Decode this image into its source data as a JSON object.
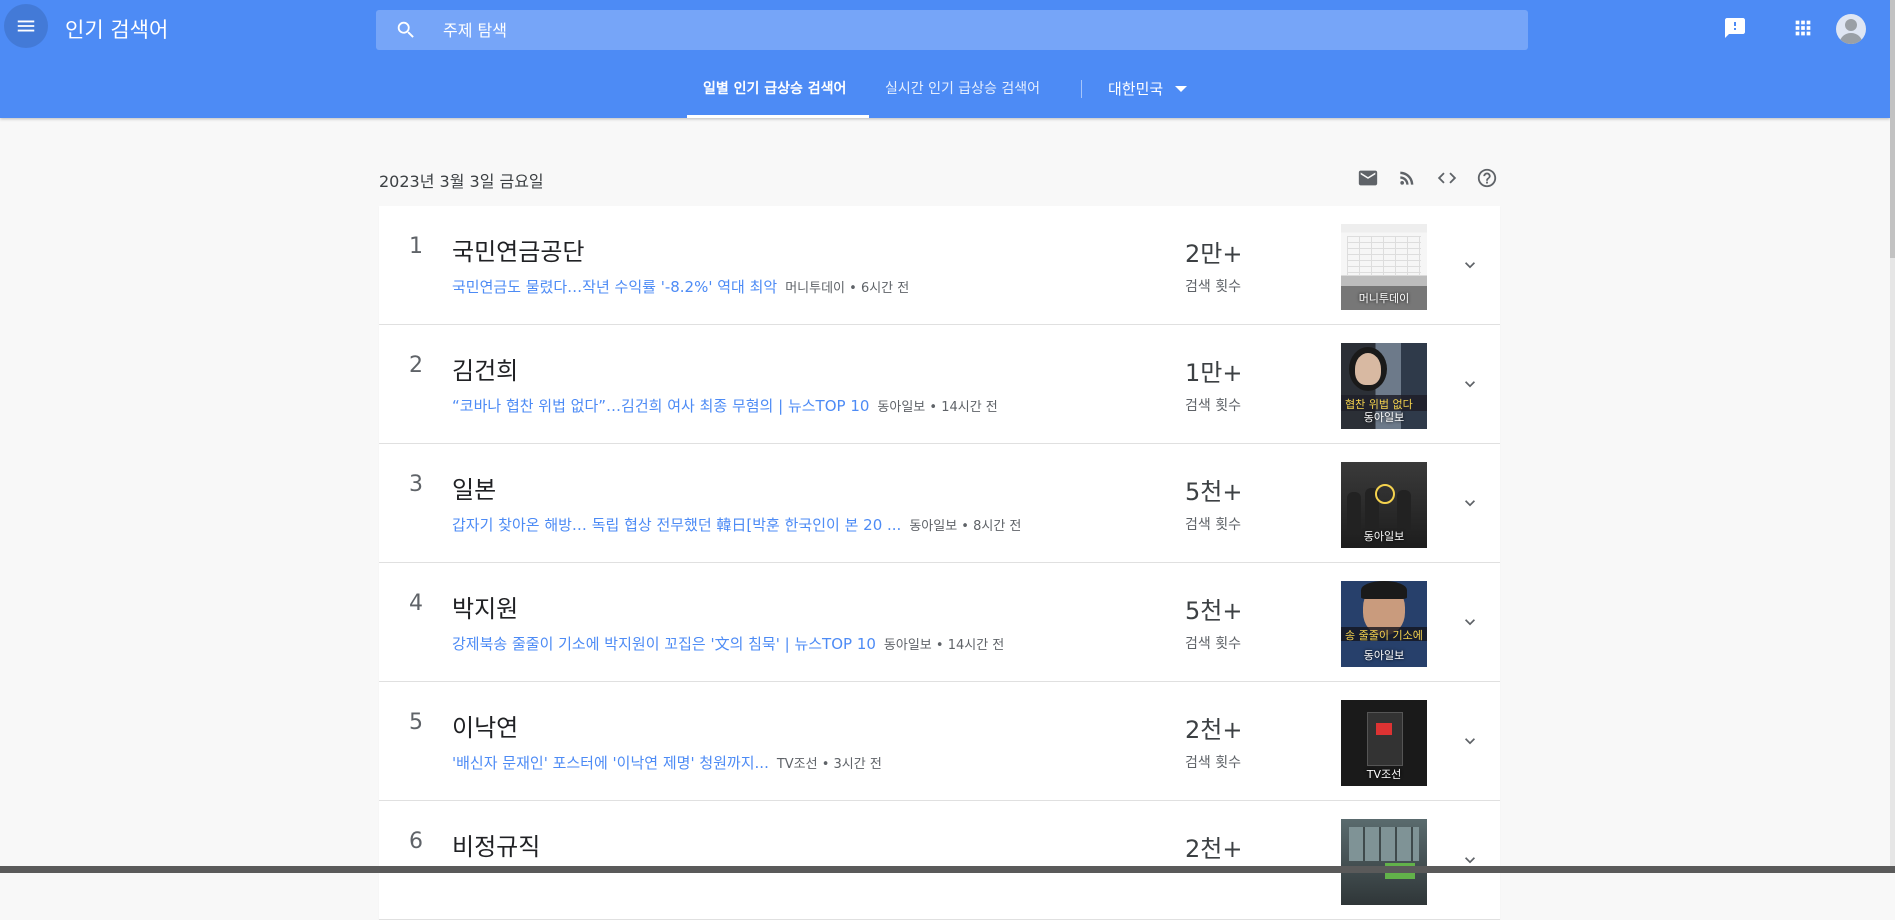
{
  "header": {
    "menu_icon": "hamburger-menu-icon",
    "title": "인기 검색어",
    "search": {
      "placeholder": "주제 탐색",
      "value": ""
    },
    "icons": [
      "feedback-icon",
      "apps-grid-icon",
      "account-avatar-icon"
    ],
    "color": "#4d8bf5"
  },
  "tabs": {
    "daily": "일별 인기 급상승 검색어",
    "realtime": "실시간 인기 급상승 검색어",
    "country": "대한민국"
  },
  "date": "2023년 3월 3일 금요일",
  "tools": [
    "email-icon",
    "rss-icon",
    "embed-code-icon",
    "help-icon"
  ],
  "count_label": "검색 횟수",
  "items": [
    {
      "rank": "1",
      "title": "국민연금공단",
      "article": "국민연금도 물렸다…작년 수익률 '-8.2%' 역대 최악",
      "source": "머니투데이 • 6시간 전",
      "count": "2만+",
      "thumb_caption": "머니투데이"
    },
    {
      "rank": "2",
      "title": "김건희",
      "article": "“코바나 협찬 위법 없다”…김건희 여사 최종 무혐의 | 뉴스TOP 10",
      "source": "동아일보 • 14시간 전",
      "count": "1만+",
      "thumb_caption": "동아일보",
      "thumb_text": "협찬 위법 없다"
    },
    {
      "rank": "3",
      "title": "일본",
      "article": "갑자기 찾아온 해방… 독립 협상 전무했던 韓日[박훈 한국인이 본 20 ...",
      "source": "동아일보 • 8시간 전",
      "count": "5천+",
      "thumb_caption": "동아일보"
    },
    {
      "rank": "4",
      "title": "박지원",
      "article": "강제북송 줄줄이 기소에 박지원이 꼬집은 '文의 침묵' | 뉴스TOP 10",
      "source": "동아일보 • 14시간 전",
      "count": "5천+",
      "thumb_caption": "동아일보",
      "thumb_text": "송 줄줄이 기소에"
    },
    {
      "rank": "5",
      "title": "이낙연",
      "article": "'배신자 문재인' 포스터에 '이낙연 제명' 청원까지...",
      "source": "TV조선 • 3시간 전",
      "count": "2천+",
      "thumb_caption": "TV조선"
    },
    {
      "rank": "6",
      "title": "비정규직",
      "article": "",
      "source": "",
      "count": "2천+",
      "thumb_caption": ""
    }
  ]
}
